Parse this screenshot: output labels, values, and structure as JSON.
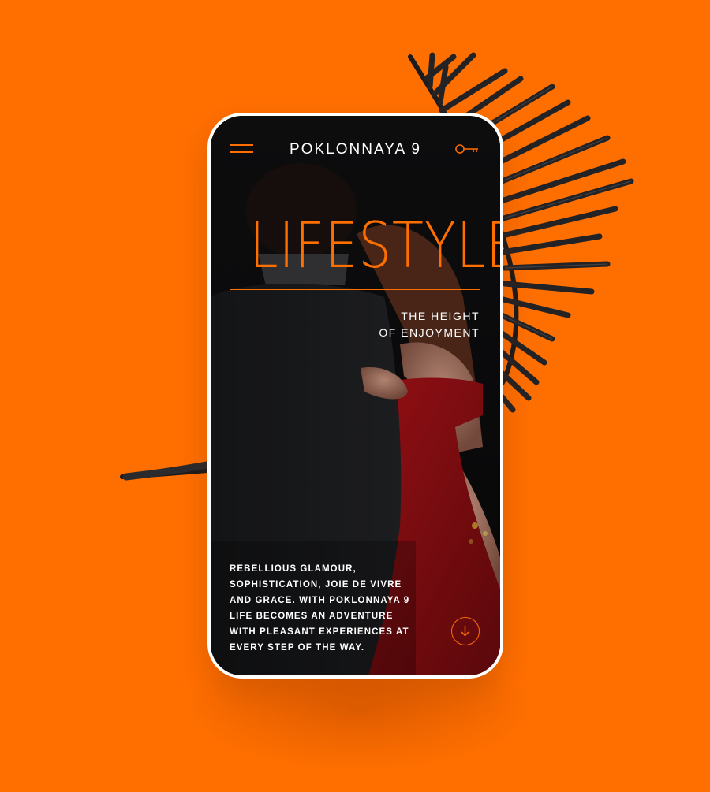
{
  "colors": {
    "background": "#ff6f00",
    "accent": "#ff6f00",
    "screen": "#0c0c0e",
    "text": "#ffffff"
  },
  "header": {
    "brand": "POKLONNAYA 9",
    "menu_icon": "hamburger-menu-icon",
    "key_icon": "key-icon"
  },
  "hero": {
    "title": "LIFESTYLE",
    "tagline_lines": [
      "THE HEIGHT",
      "OF ENJOYMENT"
    ]
  },
  "description_lines": [
    "REBELLIOUS GLAMOUR,",
    "SOPHISTICATION, JOIE DE VIVRE",
    "AND GRACE. WITH POKLONNAYA 9",
    "LIFE BECOMES AN ADVENTURE",
    "WITH PLEASANT EXPERIENCES AT",
    "EVERY STEP OF THE WAY."
  ],
  "scroll_button_icon": "arrow-down-icon"
}
